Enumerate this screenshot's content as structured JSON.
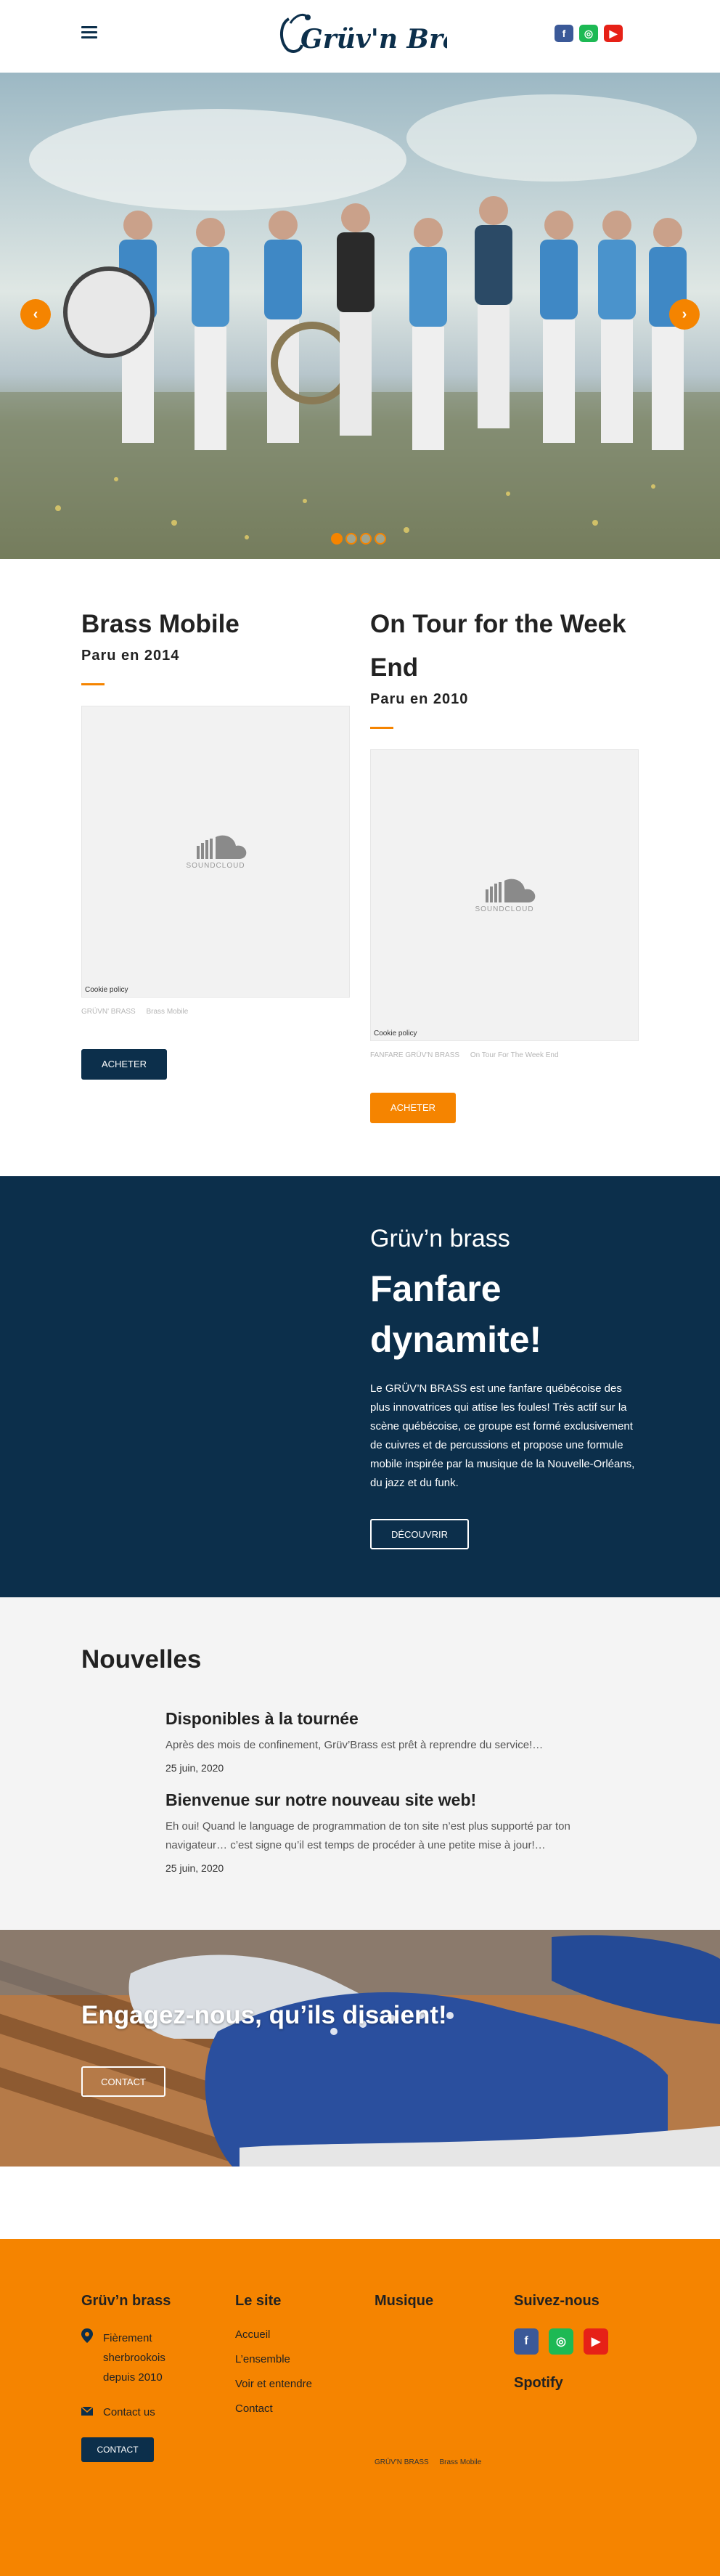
{
  "header": {
    "logo_text": "Grüv'n Brass",
    "social": [
      {
        "icon": "facebook-icon",
        "glyph": "f",
        "color": "#3b5998"
      },
      {
        "icon": "spotify-icon",
        "glyph": "◎",
        "color": "#1db954"
      },
      {
        "icon": "youtube-icon",
        "glyph": "▶",
        "color": "#e62117"
      }
    ]
  },
  "hero": {
    "prev_glyph": "‹",
    "next_glyph": "›",
    "slides_count": 4,
    "active_slide": 1
  },
  "albums": [
    {
      "title": "Brass Mobile",
      "year": "Paru en 2014",
      "embed_brand": "SOUNDCLOUD",
      "cookie": "Cookie policy",
      "credit_artist": "GRÜVN' BRASS",
      "credit_track": "Brass Mobile",
      "buy_label": "ACHETER"
    },
    {
      "title": "On Tour for the Week End",
      "year": "Paru en 2010",
      "embed_brand": "SOUNDCLOUD",
      "cookie": "Cookie policy",
      "credit_artist": "FANFARE GRÜV'N BRASS",
      "credit_track": "On Tour For The Week End",
      "buy_label": "ACHETER"
    }
  ],
  "intro": {
    "kicker": "Grüv’n brass",
    "headline": "Fanfare dynamite!",
    "body": "Le GRÜV’N BRASS est une fanfare québécoise des plus innovatrices qui attise les foules! Très actif sur la scène québécoise, ce groupe est formé exclusivement de cuivres et de percussions et propose une formule mobile inspirée par la musique de la Nouvelle-Orléans, du jazz et du funk.",
    "button": "DÉCOUVRIR"
  },
  "news": {
    "title": "Nouvelles",
    "items": [
      {
        "title": "Disponibles à la tournée",
        "excerpt": "Après des mois de confinement, Grüv’Brass est prêt à reprendre du service!…",
        "date": "25 juin, 2020"
      },
      {
        "title": "Bienvenue sur notre nouveau site web!",
        "excerpt": "Eh oui! Quand le language de programmation de ton site n’est plus supporté par ton navigateur… c’est signe qu’il est temps de procéder à une petite mise à jour!…",
        "date": "25 juin, 2020"
      }
    ]
  },
  "banner": {
    "headline": "Engagez-nous, qu’ils disaient!",
    "button": "CONTACT"
  },
  "footer": {
    "col1": {
      "title": "Grüv’n brass",
      "address": "Fièrement sherbrookois depuis 2010",
      "contact_link": "Contact us",
      "contact_button": "CONTACT"
    },
    "col2": {
      "title": "Le site",
      "links": [
        "Accueil",
        "L’ensemble",
        "Voir et entendre",
        "Contact"
      ]
    },
    "col3": {
      "title": "Musique",
      "credit_artist": "GRÜV'N BRASS",
      "credit_track": "Brass Mobile"
    },
    "col4": {
      "title": "Suivez-nous",
      "spotify_title": "Spotify"
    }
  },
  "colors": {
    "navy": "#0c2f4b",
    "orange": "#f58400",
    "light_gray": "#f4f4f4"
  }
}
